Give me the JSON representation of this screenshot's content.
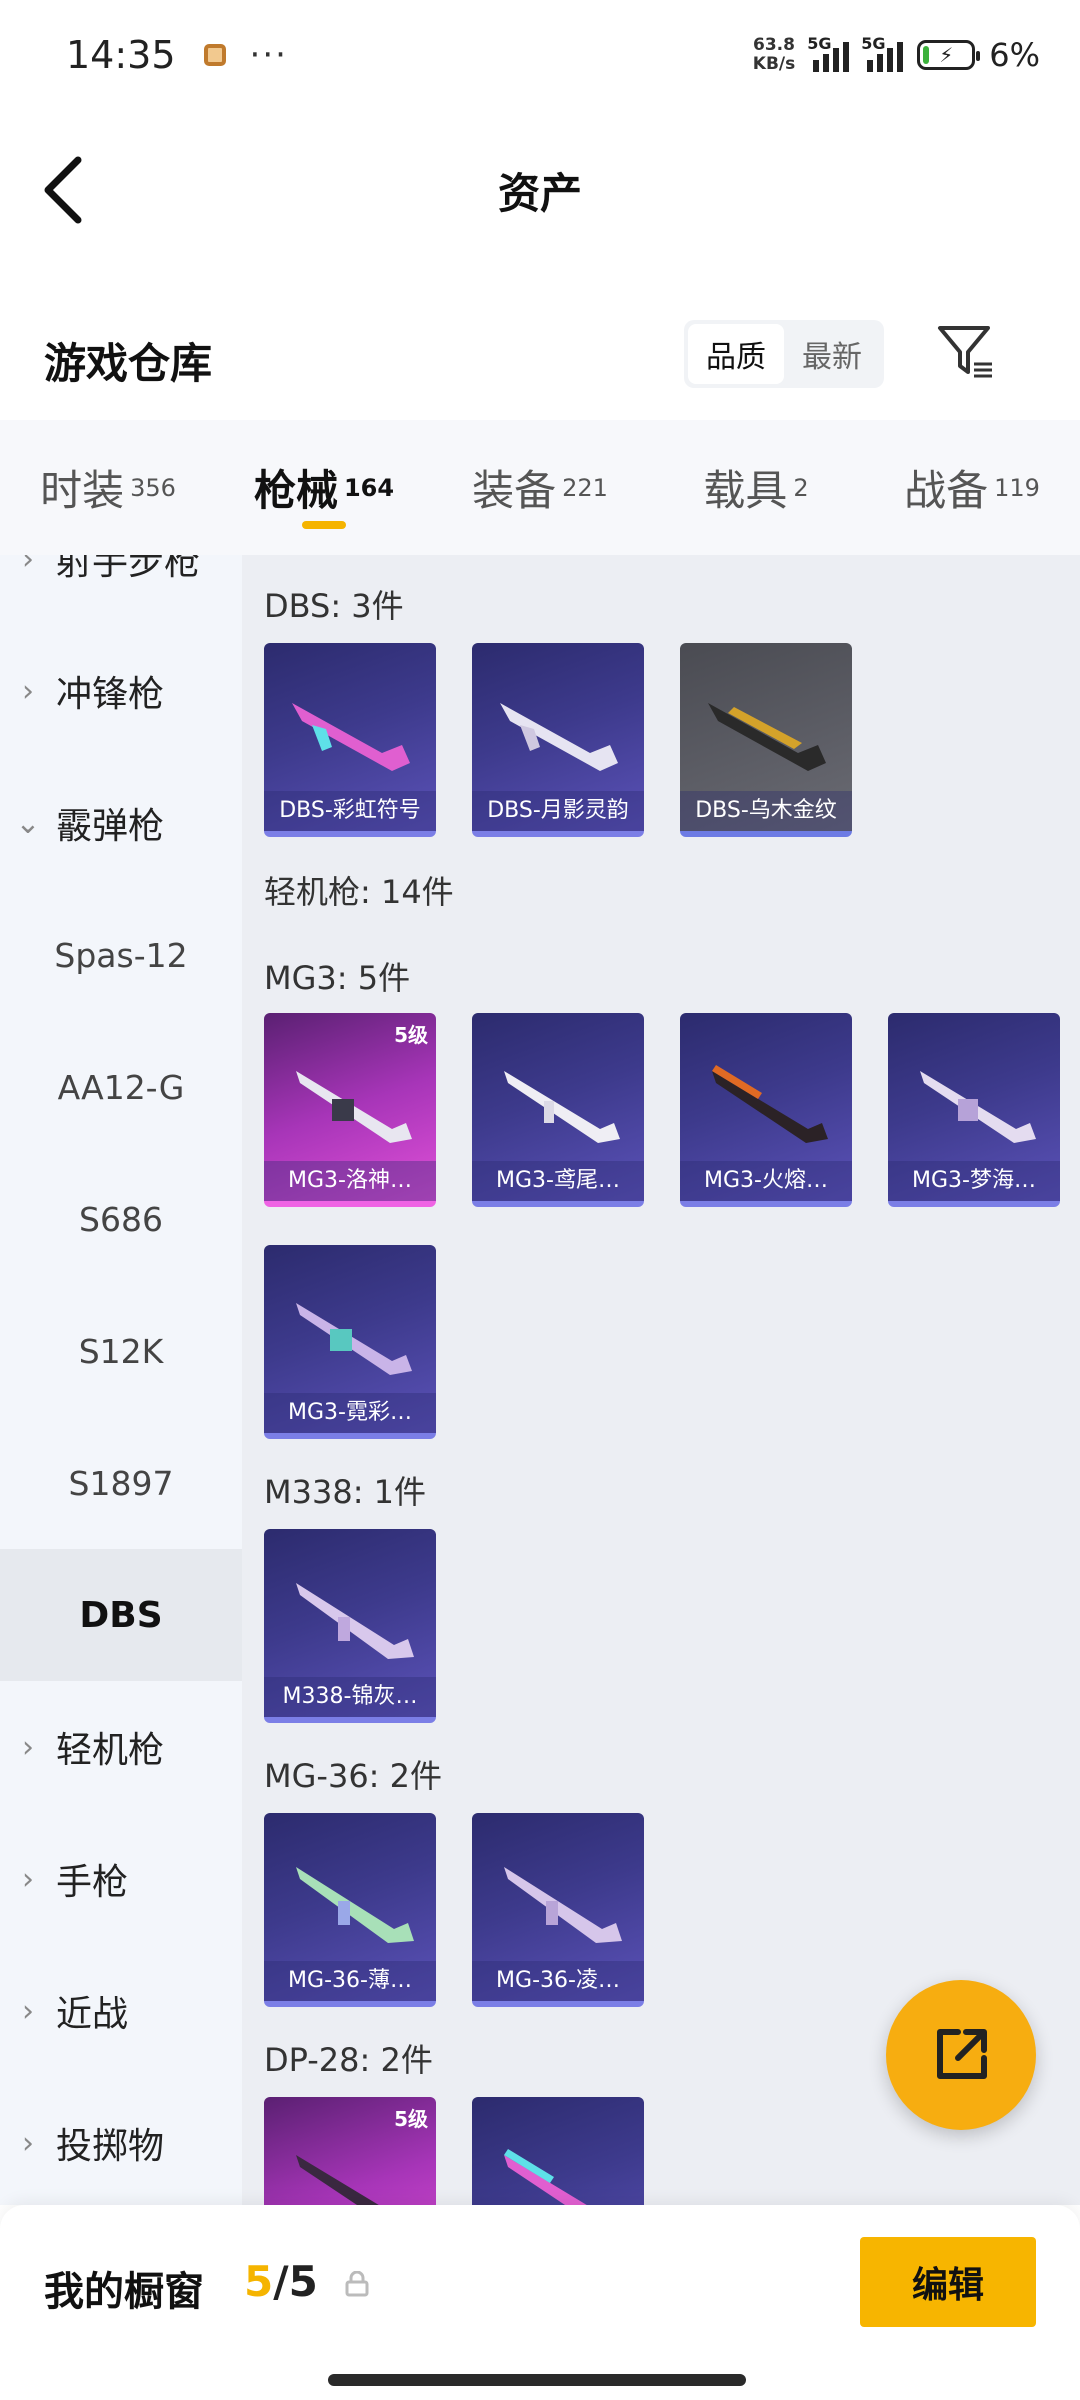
{
  "status_bar": {
    "time": "14:35",
    "dots": "···",
    "net_speed": "63.8",
    "net_unit": "KB/s",
    "sim1": "5G",
    "sim2": "5G",
    "battery": "6%"
  },
  "header": {
    "title": "资产"
  },
  "section": {
    "title": "游戏仓库",
    "sort_options": [
      "品质",
      "最新"
    ],
    "active_sort": "品质"
  },
  "tabs": [
    {
      "label": "时装",
      "count": "356"
    },
    {
      "label": "枪械",
      "count": "164",
      "active": true
    },
    {
      "label": "装备",
      "count": "221"
    },
    {
      "label": "载具",
      "count": "2"
    },
    {
      "label": "战备",
      "count": "119"
    }
  ],
  "sidebar": {
    "items": [
      {
        "label": "射手步枪",
        "type": "group"
      },
      {
        "label": "冲锋枪",
        "type": "group"
      },
      {
        "label": "霰弹枪",
        "type": "group-open"
      },
      {
        "label": "Spas-12",
        "type": "sub"
      },
      {
        "label": "AA12-G",
        "type": "sub"
      },
      {
        "label": "S686",
        "type": "sub"
      },
      {
        "label": "S12K",
        "type": "sub"
      },
      {
        "label": "S1897",
        "type": "sub"
      },
      {
        "label": "DBS",
        "type": "selected"
      },
      {
        "label": "轻机枪",
        "type": "group"
      },
      {
        "label": "手枪",
        "type": "group"
      },
      {
        "label": "近战",
        "type": "group"
      },
      {
        "label": "投掷物",
        "type": "group"
      }
    ]
  },
  "content": {
    "sections": [
      {
        "label": "DBS: 3件",
        "items": [
          {
            "name": "DBS-彩虹符号",
            "style": "blue"
          },
          {
            "name": "DBS-月影灵韵",
            "style": "blue"
          },
          {
            "name": "DBS-乌木金纹",
            "style": "gray"
          }
        ]
      },
      {
        "label": "轻机枪: 14件",
        "items": []
      },
      {
        "label": "MG3: 5件",
        "items": [
          {
            "name": "MG3-洛神…",
            "style": "pink",
            "level": "5级"
          },
          {
            "name": "MG3-鸢尾…",
            "style": "blue"
          },
          {
            "name": "MG3-火熔…",
            "style": "blue"
          },
          {
            "name": "MG3-梦海…",
            "style": "blue"
          },
          {
            "name": "MG3-霓彩…",
            "style": "blue"
          }
        ]
      },
      {
        "label": "M338: 1件",
        "items": [
          {
            "name": "M338-锦灰…",
            "style": "blue"
          }
        ]
      },
      {
        "label": "MG-36: 2件",
        "items": [
          {
            "name": "MG-36-薄…",
            "style": "blue"
          },
          {
            "name": "MG-36-凌…",
            "style": "blue"
          }
        ]
      },
      {
        "label": "DP-28: 2件",
        "items": [
          {
            "name": "",
            "style": "pink",
            "level": "5级"
          },
          {
            "name": "",
            "style": "blue"
          }
        ]
      }
    ]
  },
  "bottom_bar": {
    "label": "我的橱窗",
    "used": "5",
    "separator": "/",
    "total": "5",
    "edit_label": "编辑"
  },
  "colors": {
    "accent": "#f5b400",
    "card_blue": "#3d3a8c",
    "card_pink": "#a735b8",
    "card_gray": "#5d5e66"
  }
}
